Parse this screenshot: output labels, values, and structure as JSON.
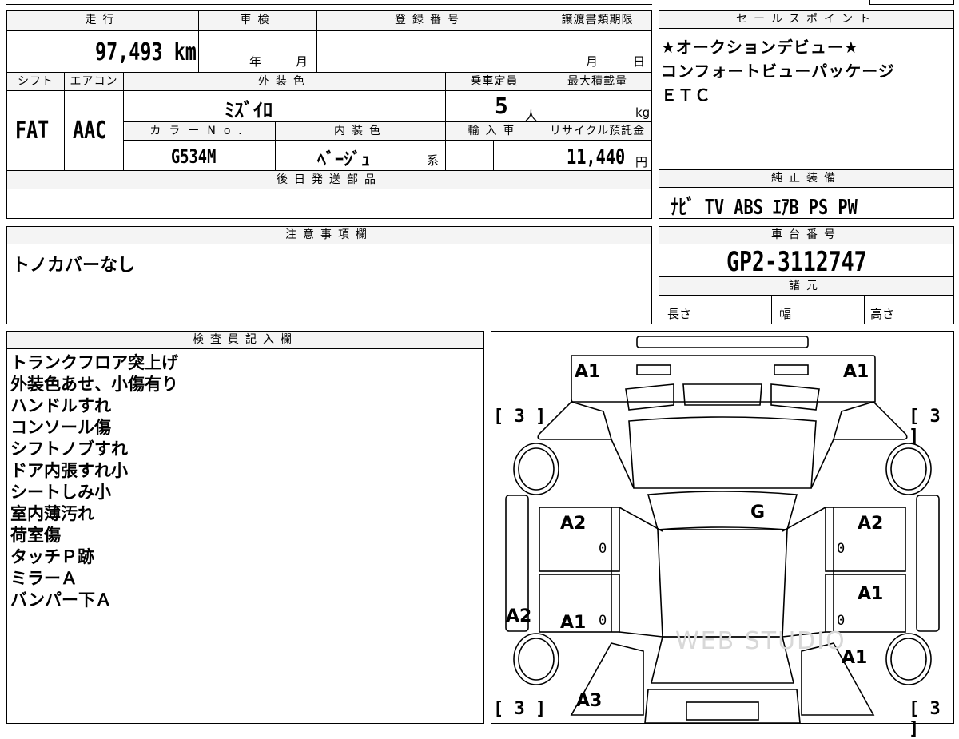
{
  "vehicle": {
    "labels": {
      "mileage": "走行",
      "inspection": "車検",
      "registration": "登録番号",
      "transfer_deadline": "譲渡書類期限",
      "shift": "シフト",
      "aircon": "エアコン",
      "exterior_color": "外装色",
      "capacity": "乗車定員",
      "max_load": "最大積載量",
      "color_no": "カラーNo.",
      "interior_color": "内装色",
      "import": "輸入車",
      "recycle": "リサイクル預託金",
      "later_parts": "後日発送部品"
    },
    "mileage_value": "97,493",
    "mileage_unit": "km",
    "inspection_year_unit": "年",
    "inspection_month_unit": "月",
    "deadline_month_unit": "月",
    "deadline_day_unit": "日",
    "shift_value": "FAT",
    "aircon_value": "AAC",
    "exterior_color_value": "ﾐｽﾞｲﾛ",
    "capacity_value": "5",
    "capacity_unit": "人",
    "max_load_unit": "kg",
    "color_no_value": "G534M",
    "interior_color_value": "ﾍﾞｰｼﾞｭ",
    "interior_color_suffix": "系",
    "recycle_value": "11,440",
    "recycle_unit": "円"
  },
  "sales_points": {
    "title": "セールスポイント",
    "lines": [
      "★オークションデビュー★",
      "コンフォートビューパッケージ",
      "ＥＴＣ"
    ]
  },
  "equipment": {
    "title": "純正装備",
    "value": "ﾅﾋﾞ TV ABS ｴｱB PS PW"
  },
  "caution": {
    "title": "注意事項欄",
    "text": "トノカバーなし"
  },
  "chassis": {
    "title": "車台番号",
    "value": "GP2-3112747",
    "specs_title": "諸元",
    "length": "長さ",
    "width": "幅",
    "height": "高さ"
  },
  "inspector": {
    "title": "検査員記入欄",
    "lines": [
      "トランクフロア突上げ",
      "外装色あせ、小傷有り",
      "ハンドルすれ",
      "コンソール傷",
      "シフトノブすれ",
      "ドア内張すれ小",
      "シートしみ小",
      "室内薄汚れ",
      "荷室傷",
      "タッチＰ跡",
      "ミラーＡ",
      "バンパー下Ａ"
    ]
  },
  "diagram": {
    "marks": {
      "rear_left": "A1",
      "rear_right": "A1",
      "glass": "G",
      "rear_door_left": "A2",
      "rear_door_right": "A2",
      "left_side": "A2",
      "front_door_left": "A1",
      "front_door_right": "A1",
      "front_fender_right": "A1",
      "front_left": "A3",
      "zero1": "0",
      "zero2": "0",
      "zero3": "0",
      "zero4": "0"
    },
    "tire_label_tl": "[ 3 ]",
    "tire_label_tr": "[ 3 ]",
    "tire_label_bl": "[ 3 ]",
    "tire_label_br": "[ 3 ]",
    "watermark": "WEB STUDIO"
  }
}
